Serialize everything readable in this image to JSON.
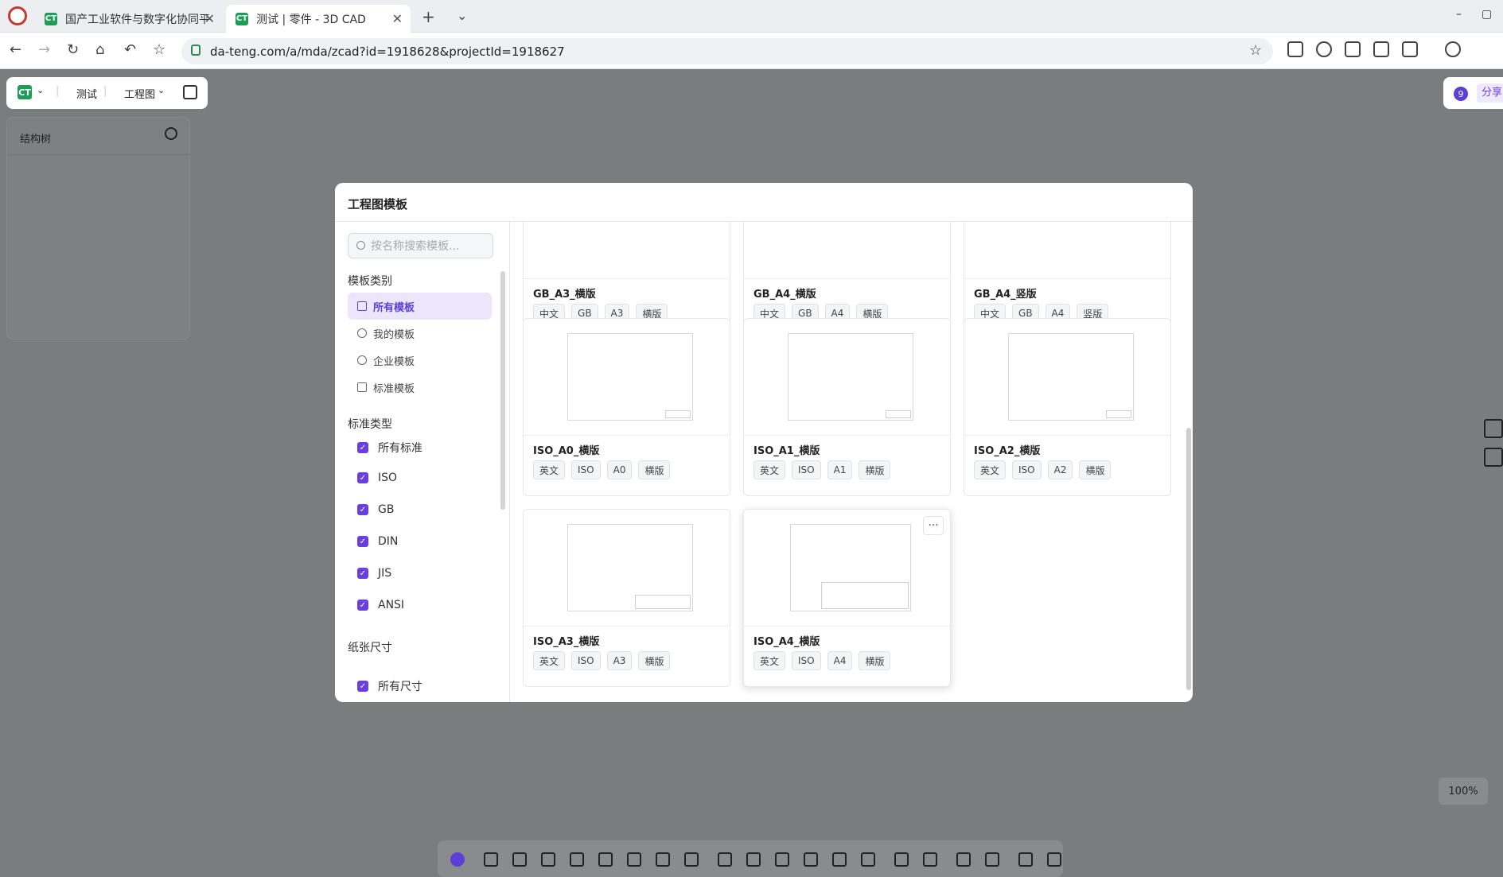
{
  "browser": {
    "tabs": [
      {
        "title": "国产工业软件与数字化协同平",
        "active": false
      },
      {
        "title": "测试 | 零件 - 3D CAD",
        "active": true
      }
    ],
    "new_tab": "+",
    "tab_menu": "⌄",
    "url": "da-teng.com/a/mda/zcad?id=1918628&projectId=1918627",
    "window_controls": [
      "–",
      "▢"
    ]
  },
  "app": {
    "logo_text": "CT",
    "project": "测试",
    "mode": "工程图",
    "right": {
      "badge": "9",
      "share": "分享"
    },
    "tree": {
      "title": "结构树"
    },
    "zoom": "100%"
  },
  "modal": {
    "title": "工程图模板",
    "search_placeholder": "按名称搜索模板...",
    "section_category": "模板类别",
    "categories": [
      "所有模板",
      "我的模板",
      "企业模板",
      "标准模板"
    ],
    "section_standard": "标准类型",
    "standards": [
      "所有标准",
      "ISO",
      "GB",
      "DIN",
      "JIS",
      "ANSI"
    ],
    "section_paper": "纸张尺寸",
    "paper_sizes": [
      "所有尺寸"
    ],
    "cards": [
      {
        "name": "GB_A3_横版",
        "tags": [
          "中文",
          "GB",
          "A3",
          "横版"
        ]
      },
      {
        "name": "GB_A4_横版",
        "tags": [
          "中文",
          "GB",
          "A4",
          "横版"
        ]
      },
      {
        "name": "GB_A4_竖版",
        "tags": [
          "中文",
          "GB",
          "A4",
          "竖版"
        ]
      },
      {
        "name": "ISO_A0_横版",
        "tags": [
          "英文",
          "ISO",
          "A0",
          "横版"
        ]
      },
      {
        "name": "ISO_A1_横版",
        "tags": [
          "英文",
          "ISO",
          "A1",
          "横版"
        ]
      },
      {
        "name": "ISO_A2_横版",
        "tags": [
          "英文",
          "ISO",
          "A2",
          "横版"
        ]
      },
      {
        "name": "ISO_A3_横版",
        "tags": [
          "英文",
          "ISO",
          "A3",
          "横版"
        ]
      },
      {
        "name": "ISO_A4_横版",
        "tags": [
          "英文",
          "ISO",
          "A4",
          "横版"
        ]
      }
    ],
    "more_button": "···"
  }
}
